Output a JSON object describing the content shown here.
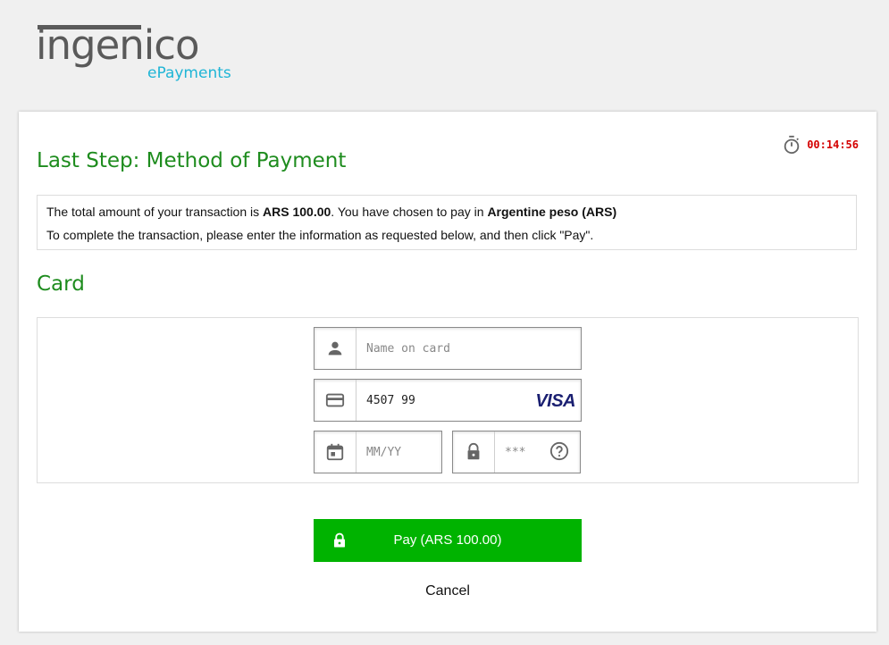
{
  "brand": {
    "name": "ingenico",
    "sub": "ePayments",
    "accent": "#1fb5d6"
  },
  "timer": {
    "value": "00:14:56",
    "icon": "stopwatch-icon",
    "color": "#d40000"
  },
  "page": {
    "title": "Last Step: Method of Payment"
  },
  "info": {
    "line1_prefix": "The total amount of your transaction is ",
    "amount": "ARS 100.00",
    "line1_mid": ". You have chosen to pay in ",
    "currency": "Argentine peso (ARS)",
    "line2": "To complete the transaction, please enter the information as requested below, and then click \"Pay\"."
  },
  "card": {
    "section_title": "Card",
    "name_placeholder": "Name on card",
    "number_value": "4507 99",
    "brand_logo": "VISA",
    "expiry_placeholder": "MM/YY",
    "cvv_placeholder": "***"
  },
  "actions": {
    "pay_label": "Pay (ARS 100.00)",
    "cancel_label": "Cancel",
    "pay_color": "#00b300"
  }
}
